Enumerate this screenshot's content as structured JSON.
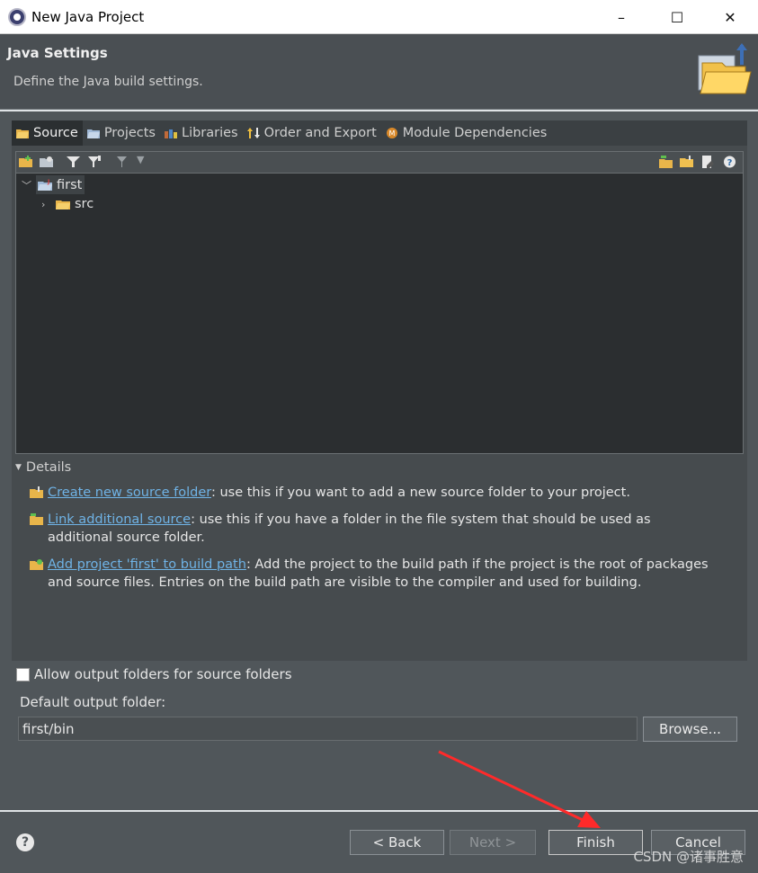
{
  "window": {
    "title": "New Java Project",
    "controls": {
      "minimize": "–",
      "maximize": "☐",
      "close": "✕"
    }
  },
  "banner": {
    "title": "Java Settings",
    "subtitle": "Define the Java build settings."
  },
  "tabs": [
    {
      "label": "Source",
      "active": true,
      "icon": "source-folder-icon"
    },
    {
      "label": "Projects",
      "active": false,
      "icon": "projects-icon"
    },
    {
      "label": "Libraries",
      "active": false,
      "icon": "libraries-icon"
    },
    {
      "label": "Order and Export",
      "active": false,
      "icon": "order-export-icon"
    },
    {
      "label": "Module Dependencies",
      "active": false,
      "icon": "module-icon"
    }
  ],
  "tree": {
    "root": {
      "label": "first",
      "expanded": true,
      "selected": true
    },
    "children": [
      {
        "label": "src",
        "expanded": false
      }
    ]
  },
  "details": {
    "header": "Details",
    "items": [
      {
        "link": "Create new source folder",
        "text": ": use this if you want to add a new source folder to your project."
      },
      {
        "link": "Link additional source",
        "text": ": use this if you have a folder in the file system that should be used as additional source folder."
      },
      {
        "link": "Add project 'first' to build path",
        "text": ": Add the project to the build path if the project is the root of packages and source files. Entries on the build path are visible to the compiler and used for building."
      }
    ]
  },
  "options": {
    "allow_output_folders": {
      "label": "Allow output folders for source folders",
      "checked": false
    },
    "default_output_label": "Default output folder:",
    "default_output_value": "first/bin",
    "browse_label": "Browse..."
  },
  "footer": {
    "help": "?",
    "back": "< Back",
    "next": "Next >",
    "finish": "Finish",
    "cancel": "Cancel"
  },
  "watermark": "CSDN @诸事胜意",
  "colors": {
    "link": "#6fb3e6",
    "arrow": "#ff2a2a"
  }
}
